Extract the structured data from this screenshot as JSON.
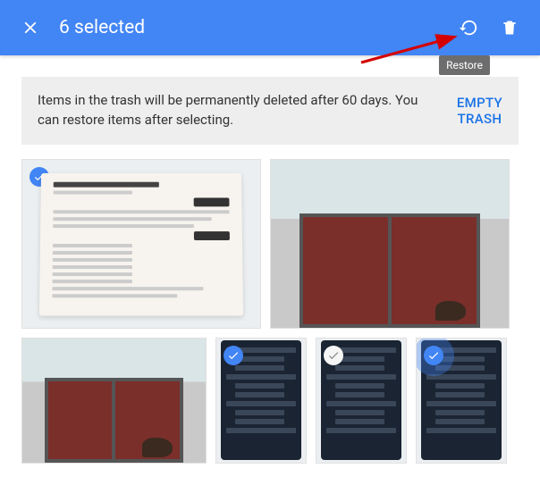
{
  "topbar": {
    "title": "6 selected",
    "close_icon": "close",
    "restore_icon": "restore",
    "delete_icon": "delete",
    "tooltip": "Restore"
  },
  "banner": {
    "text": "Items in the trash will be permanently deleted after 60 days. You can restore items after selecting.",
    "action_line1": "EMPTY",
    "action_line2": "TRASH"
  },
  "thumbs": [
    {
      "kind": "doc",
      "selected": true,
      "halo": false
    },
    {
      "kind": "gate",
      "selected": true,
      "halo": false
    },
    {
      "kind": "gate",
      "selected": false,
      "halo": false
    },
    {
      "kind": "tablet",
      "selected": true,
      "halo": false
    },
    {
      "kind": "tablet",
      "selected": false,
      "halo": false
    },
    {
      "kind": "tablet",
      "selected": true,
      "halo": true
    }
  ]
}
